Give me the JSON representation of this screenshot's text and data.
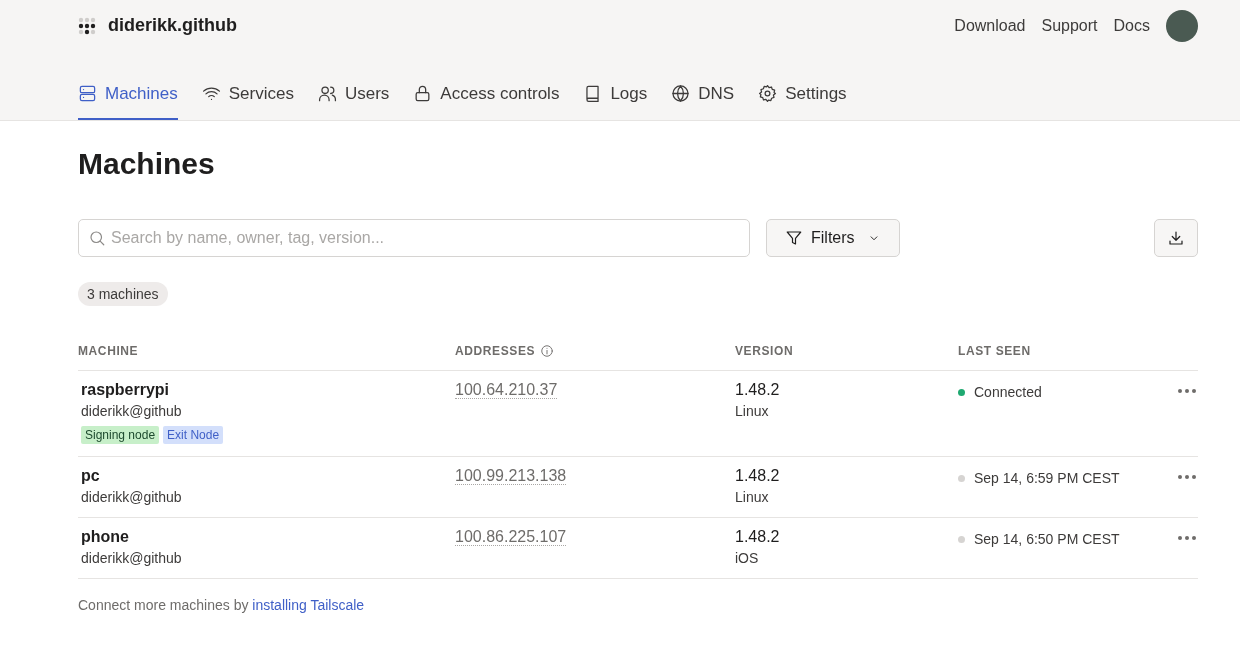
{
  "header": {
    "org": "diderikk.github",
    "links": [
      "Download",
      "Support",
      "Docs"
    ]
  },
  "tabs": [
    {
      "label": "Machines",
      "kind": "machines",
      "selected": true
    },
    {
      "label": "Services",
      "kind": "services",
      "selected": false
    },
    {
      "label": "Users",
      "kind": "users",
      "selected": false
    },
    {
      "label": "Access controls",
      "kind": "access",
      "selected": false
    },
    {
      "label": "Logs",
      "kind": "logs",
      "selected": false
    },
    {
      "label": "DNS",
      "kind": "dns",
      "selected": false
    },
    {
      "label": "Settings",
      "kind": "settings",
      "selected": false
    }
  ],
  "page_title": "Machines",
  "search": {
    "placeholder": "Search by name, owner, tag, version..."
  },
  "filters_button": "Filters",
  "count_badge": "3 machines",
  "table": {
    "columns": [
      "MACHINE",
      "ADDRESSES",
      "VERSION",
      "LAST SEEN"
    ],
    "rows": [
      {
        "name": "raspberrypi",
        "owner": "diderikk@github",
        "tags": [
          {
            "label": "Signing node",
            "color": "#c7efc9"
          },
          {
            "label": "Exit Node",
            "color": "#d3dffb"
          }
        ],
        "address": "100.64.210.37",
        "version": "1.48.2",
        "os": "Linux",
        "last_seen": "Connected",
        "color": "#1fa971"
      },
      {
        "name": "pc",
        "owner": "diderikk@github",
        "address": "100.99.213.138",
        "version": "1.48.2",
        "os": "Linux",
        "last_seen": "Sep 14, 6:59 PM CEST",
        "color": "#d6d4d2"
      },
      {
        "name": "phone",
        "owner": "diderikk@github",
        "address": "100.86.225.107",
        "version": "1.48.2",
        "os": "iOS",
        "last_seen": "Sep 14, 6:50 PM CEST",
        "color": "#d6d4d2"
      }
    ]
  },
  "footer": {
    "text": "Connect more machines by ",
    "link": "installing Tailscale"
  }
}
